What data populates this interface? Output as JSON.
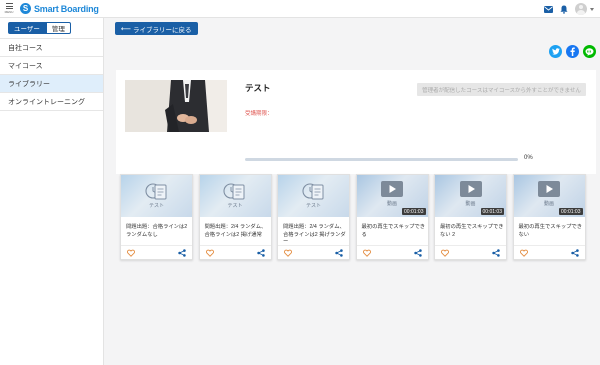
{
  "app": {
    "menu_label": "MENU",
    "logo_letter": "S",
    "logo_text": "Smart Boarding"
  },
  "icons": {
    "brand_color": "#1e88d8",
    "accent_color": "#1a5fa6",
    "twitter_color": "#1da1f2",
    "facebook_color": "#1877f2",
    "line_color": "#00b900"
  },
  "sidebar": {
    "toggle": {
      "user_label": "ユーザー",
      "admin_label": "管理"
    },
    "items": [
      {
        "label": "自社コース"
      },
      {
        "label": "マイコース"
      },
      {
        "label": "ライブラリー"
      },
      {
        "label": "オンライントレーニング"
      }
    ]
  },
  "main": {
    "back_label": "ライブラリーに戻る",
    "course": {
      "title": "テスト",
      "period_label": "受講期限：",
      "notice": "管理者が配信したコースはマイコースから外すことができません",
      "progress_value": 0,
      "progress_label": "0%"
    },
    "cards": [
      {
        "title": "問題出題：合格ラインは2 ランダムなし",
        "kind": "test",
        "thumb_label": "テスト",
        "duration": ""
      },
      {
        "title": "問題出題：2/4 ランダム、合格ラインは2 掲げ通常",
        "kind": "test",
        "thumb_label": "テスト",
        "duration": ""
      },
      {
        "title": "問題出題：2/4 ランダム、合格ラインは2 掲げランダー",
        "kind": "test",
        "thumb_label": "テスト",
        "duration": ""
      },
      {
        "title": "最初の再生でスキップできる",
        "kind": "video",
        "thumb_label": "動画",
        "duration": "00:01:03"
      },
      {
        "title": "最初の再生でスキップできない 2",
        "kind": "video",
        "thumb_label": "動画",
        "duration": "00:01:03"
      },
      {
        "title": "最初の再生でスキップできない",
        "kind": "video",
        "thumb_label": "動画",
        "duration": "00:01:03"
      }
    ]
  }
}
